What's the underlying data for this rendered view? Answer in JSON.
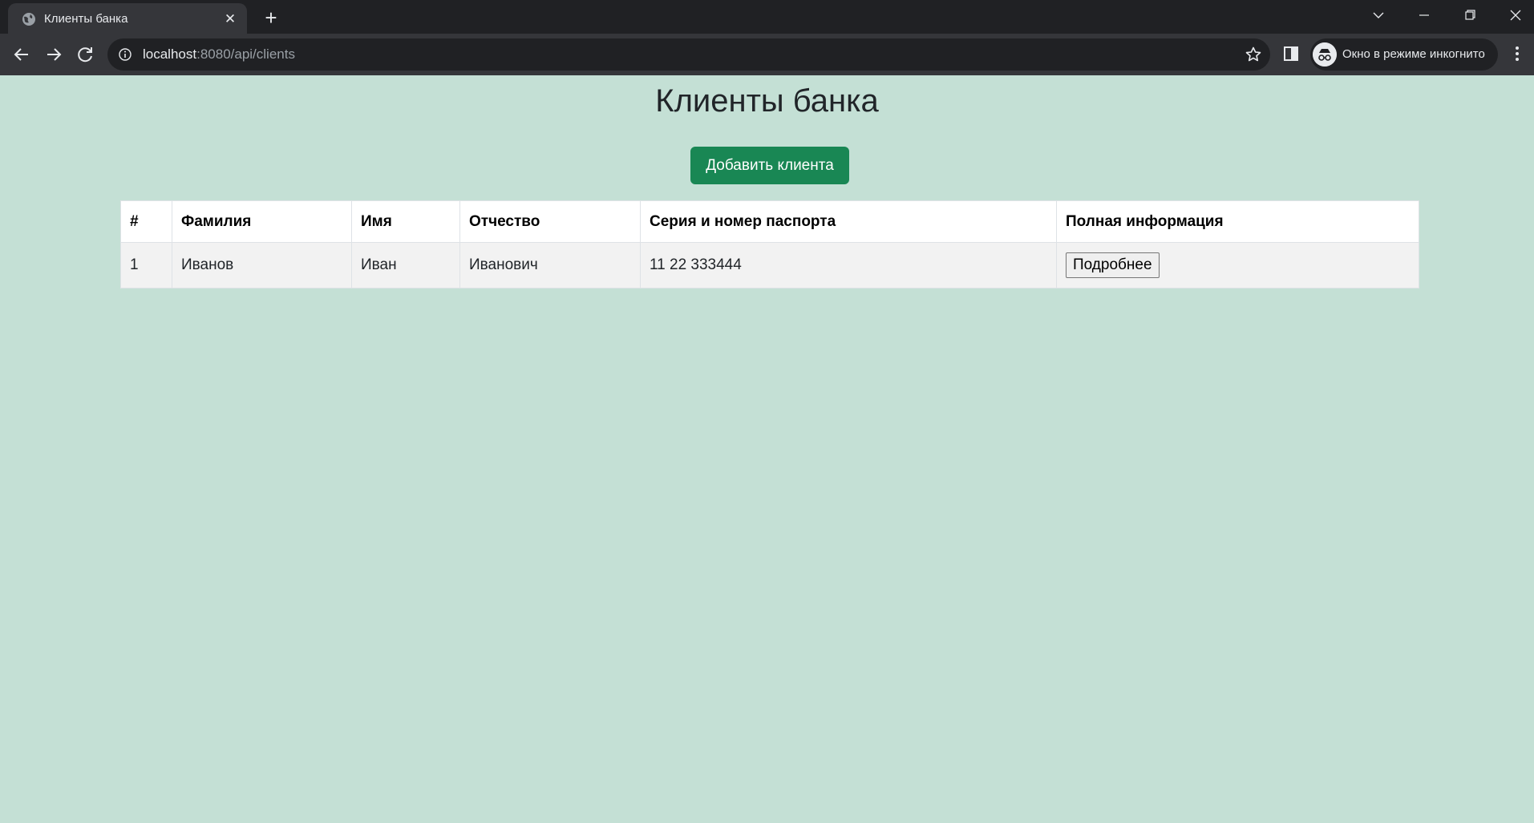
{
  "browser": {
    "tab_title": "Клиенты банка",
    "tab_close": "✕",
    "new_tab": "+",
    "url_host": "localhost",
    "url_rest": ":8080/api/clients",
    "incognito_label": "Окно в режиме инкогнито"
  },
  "page": {
    "title": "Клиенты банка",
    "add_button_label": "Добавить клиента",
    "add_button_color": "#198754",
    "background_color": "#c4e0d5"
  },
  "table": {
    "headers": [
      "#",
      "Фамилия",
      "Имя",
      "Отчество",
      "Серия и номер паспорта",
      "Полная информация"
    ],
    "rows": [
      {
        "num": "1",
        "last_name": "Иванов",
        "first_name": "Иван",
        "patronymic": "Иванович",
        "passport": "11 22 333444",
        "details_label": "Подробнее"
      }
    ]
  }
}
